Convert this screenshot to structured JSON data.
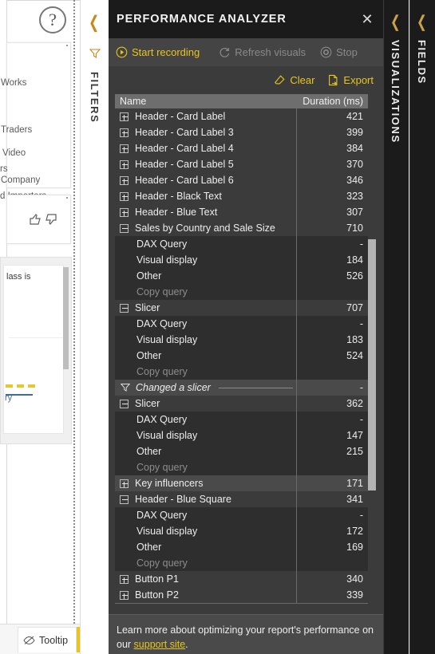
{
  "canvas": {
    "help_icon": "question-mark-icon",
    "list_items": [
      "Works",
      "Traders",
      "Video",
      "rs",
      "Company",
      "d Importers"
    ],
    "thumbs": "👍 👎",
    "card_c_text": "lass is",
    "card_c_text2": "ry",
    "page_tab": {
      "label": "Tooltip",
      "icon": "hidden-page-icon"
    },
    "add_page_label": "+"
  },
  "filters_pane": {
    "label": "FILTERS",
    "collapse_icon": "chevron-left-icon",
    "funnel_icon": "filter-funnel-icon"
  },
  "performance_analyzer": {
    "title": "PERFORMANCE ANALYZER",
    "close_icon": "close-icon",
    "toolbar": {
      "start_recording": "Start recording",
      "refresh_visuals": "Refresh visuals",
      "stop": "Stop",
      "clear": "Clear",
      "export": "Export"
    },
    "columns": {
      "name": "Name",
      "duration": "Duration (ms)"
    },
    "rows": [
      {
        "type": "visual",
        "state": "collapsed",
        "name": "Header - Card Label",
        "duration": "421"
      },
      {
        "type": "visual",
        "state": "collapsed",
        "name": "Header - Card Label 3",
        "duration": "399"
      },
      {
        "type": "visual",
        "state": "collapsed",
        "name": "Header - Card Label 4",
        "duration": "384"
      },
      {
        "type": "visual",
        "state": "collapsed",
        "name": "Header - Card Label 5",
        "duration": "370"
      },
      {
        "type": "visual",
        "state": "collapsed",
        "name": "Header - Card Label 6",
        "duration": "346"
      },
      {
        "type": "visual",
        "state": "collapsed",
        "name": "Header - Black Text",
        "duration": "323"
      },
      {
        "type": "visual",
        "state": "collapsed",
        "name": "Header - Blue Text",
        "duration": "307"
      },
      {
        "type": "visual",
        "state": "expanded",
        "name": "Sales by Country and Sale Size",
        "duration": "710"
      },
      {
        "type": "child",
        "name": "DAX Query",
        "duration": "-"
      },
      {
        "type": "child",
        "name": "Visual display",
        "duration": "184"
      },
      {
        "type": "child",
        "name": "Other",
        "duration": "526"
      },
      {
        "type": "action",
        "name": "Copy query",
        "duration": ""
      },
      {
        "type": "visual",
        "state": "expanded",
        "name": "Slicer",
        "duration": "707"
      },
      {
        "type": "child",
        "name": "DAX Query",
        "duration": "-"
      },
      {
        "type": "child",
        "name": "Visual display",
        "duration": "183"
      },
      {
        "type": "child",
        "name": "Other",
        "duration": "524"
      },
      {
        "type": "action",
        "name": "Copy query",
        "duration": ""
      },
      {
        "type": "event",
        "name": "Changed a slicer",
        "duration": "-"
      },
      {
        "type": "visual",
        "state": "expanded",
        "name": "Slicer",
        "duration": "362"
      },
      {
        "type": "child",
        "name": "DAX Query",
        "duration": "-"
      },
      {
        "type": "child",
        "name": "Visual display",
        "duration": "147"
      },
      {
        "type": "child",
        "name": "Other",
        "duration": "215"
      },
      {
        "type": "action",
        "name": "Copy query",
        "duration": ""
      },
      {
        "type": "visual",
        "state": "collapsed",
        "hover": true,
        "name": "Key influencers",
        "duration": "171"
      },
      {
        "type": "visual",
        "state": "expanded",
        "name": "Header - Blue Square",
        "duration": "341"
      },
      {
        "type": "child",
        "name": "DAX Query",
        "duration": "-"
      },
      {
        "type": "child",
        "name": "Visual display",
        "duration": "172"
      },
      {
        "type": "child",
        "name": "Other",
        "duration": "169"
      },
      {
        "type": "action",
        "name": "Copy query",
        "duration": ""
      },
      {
        "type": "visual",
        "state": "collapsed",
        "name": "Button P1",
        "duration": "340"
      },
      {
        "type": "visual",
        "state": "collapsed",
        "name": "Button P2",
        "duration": "339"
      }
    ],
    "footer": {
      "text_before": "Learn more about optimizing your report's performance on our ",
      "link": "support site",
      "text_after": "."
    }
  },
  "right_panes": [
    {
      "label": "VISUALIZATIONS",
      "collapse_icon": "chevron-left-icon"
    },
    {
      "label": "FIELDS",
      "collapse_icon": "chevron-left-icon"
    }
  ],
  "colors": {
    "accent": "#e8c51c",
    "panel_bg": "#3b3b3b",
    "title_bg": "#1b1b1b",
    "header_bg": "#6e6e6e"
  }
}
